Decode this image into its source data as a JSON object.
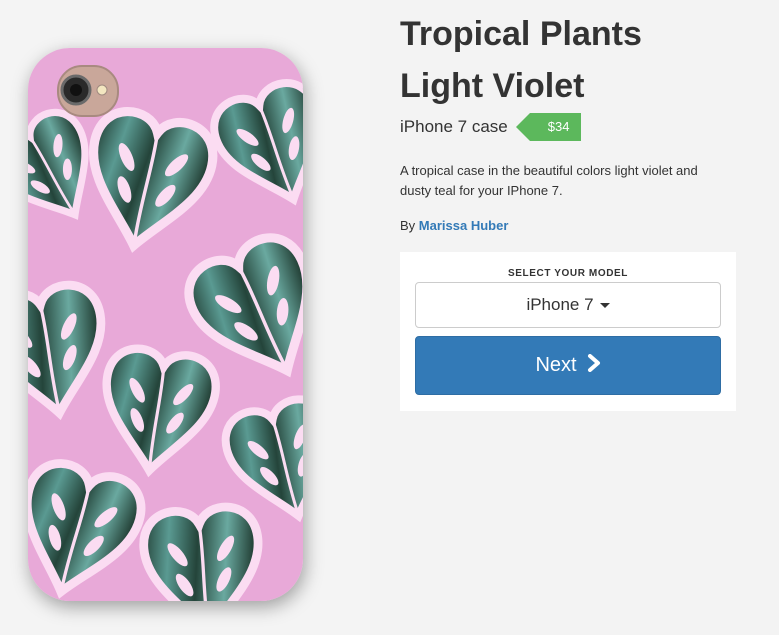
{
  "product": {
    "title_line1": "Tropical Plants",
    "title_line2": "Light Violet",
    "case_label": "iPhone 7 case",
    "price": "$34",
    "description": "A tropical case in the beautiful colors light violet and dusty teal for your IPhone 7.",
    "by_label": "By",
    "author": "Marissa Huber"
  },
  "model_selector": {
    "label": "SELECT YOUR MODEL",
    "selected": "iPhone 7",
    "next_label": "Next"
  },
  "icons": {
    "dropdown": "caret-down-icon",
    "next": "chevron-right-icon"
  },
  "colors": {
    "price_tag": "#5cb85c",
    "primary_button": "#337ab7",
    "author_link": "#337ab7",
    "case_background": "#e8a9d8",
    "leaf_teal": "#5a9a92",
    "leaf_dark": "#1f3a30",
    "leaf_outline": "#fbdcf2"
  }
}
